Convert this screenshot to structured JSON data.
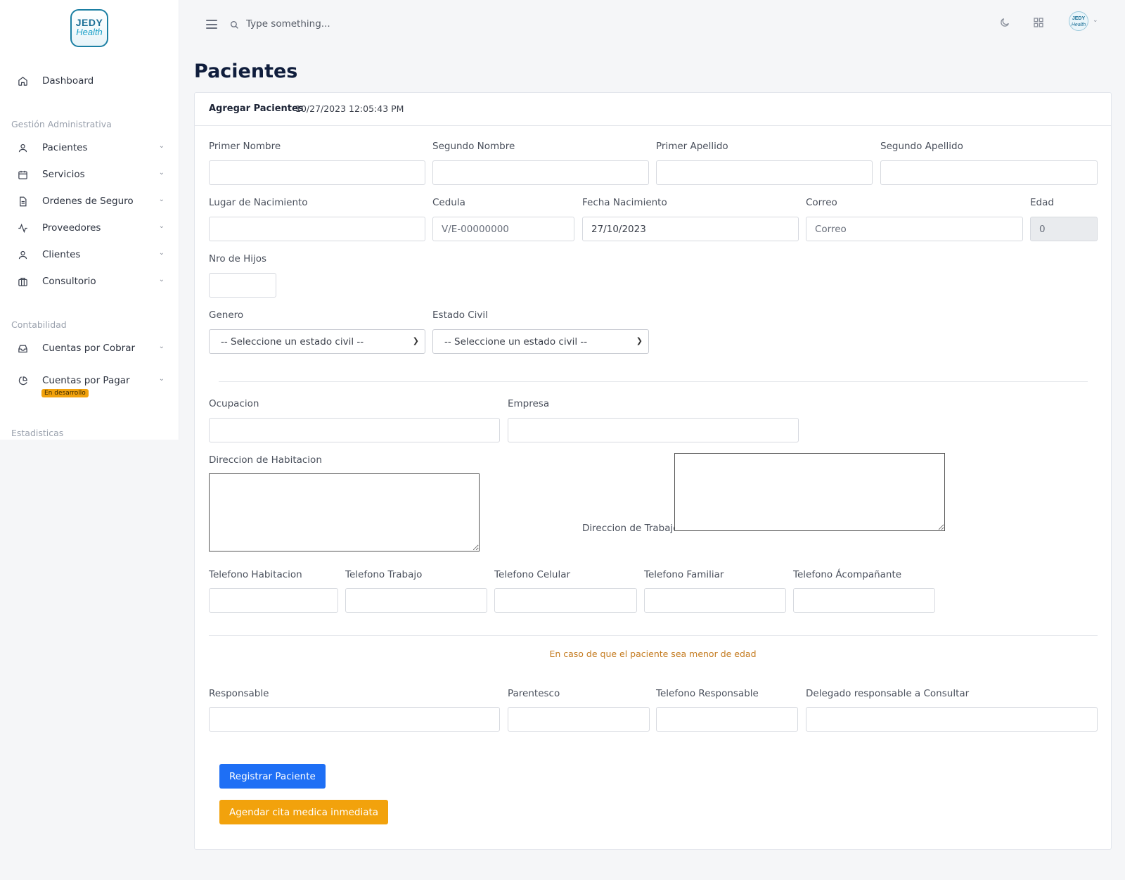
{
  "brand": {
    "logo_line1": "JEDY",
    "logo_line2": "Health",
    "avatar_line1": "JEDY",
    "avatar_line2": "Health"
  },
  "sidebar": {
    "dashboard": "Dashboard",
    "section_admin": "Gestión Administrativa",
    "items": [
      {
        "label": "Pacientes",
        "icon": "user-icon"
      },
      {
        "label": "Servicios",
        "icon": "calendar-icon"
      },
      {
        "label": "Ordenes de Seguro",
        "icon": "document-icon"
      },
      {
        "label": "Proveedores",
        "icon": "activity-icon"
      },
      {
        "label": "Clientes",
        "icon": "user-icon"
      },
      {
        "label": "Consultorio",
        "icon": "briefcase-icon"
      }
    ],
    "section_accounting": "Contabilidad",
    "accounting_items": [
      {
        "label": "Cuentas por Cobrar",
        "icon": "inbox-icon"
      },
      {
        "label": "Cuentas por Pagar",
        "icon": "pie-chart-icon",
        "badge": "En desarrollo"
      }
    ],
    "section_stats": "Estadisticas"
  },
  "topbar": {
    "search_placeholder": "Type something..."
  },
  "page": {
    "title": "Pacientes"
  },
  "card": {
    "header": "Agregar Pacientes",
    "timestamp": "10/27/2023 12:05:43 PM"
  },
  "form": {
    "primer_nombre": "Primer Nombre",
    "segundo_nombre": "Segundo Nombre",
    "primer_apellido": "Primer Apellido",
    "segundo_apellido": "Segundo Apellido",
    "lugar_nacimiento": "Lugar de Nacimiento",
    "cedula": "Cedula",
    "cedula_placeholder": "V/E-00000000",
    "fecha_nacimiento": "Fecha Nacimiento",
    "fecha_value": "27/10/2023",
    "correo": "Correo",
    "correo_placeholder": "Correo",
    "edad": "Edad",
    "edad_value": "0",
    "nro_hijos": "Nro de Hijos",
    "genero": "Genero",
    "genero_select": "-- Seleccione un estado civil --",
    "estado_civil": "Estado Civil",
    "estado_civil_select": "-- Seleccione un estado civil --",
    "ocupacion": "Ocupacion",
    "empresa": "Empresa",
    "direccion_habitacion": "Direccion de Habitacion",
    "direccion_trabajo": "Direccion de Trabajo",
    "tel_habitacion": "Telefono Habitacion",
    "tel_trabajo": "Telefono Trabajo",
    "tel_celular": "Telefono Celular",
    "tel_familiar": "Telefono Familiar",
    "tel_acompanante": "Telefono Ácompañante",
    "minor_note": "En caso de que el paciente sea menor de edad",
    "responsable": "Responsable",
    "parentesco": "Parentesco",
    "tel_responsable": "Telefono Responsable",
    "delegado": "Delegado responsable a Consultar"
  },
  "buttons": {
    "registrar": "Registrar Paciente",
    "agendar": "Agendar cita medica inmediata"
  },
  "colors": {
    "primary": "#1e6ff5",
    "warning": "#f2a20c",
    "title": "#0f1d3c",
    "note": "#c47a1e"
  }
}
